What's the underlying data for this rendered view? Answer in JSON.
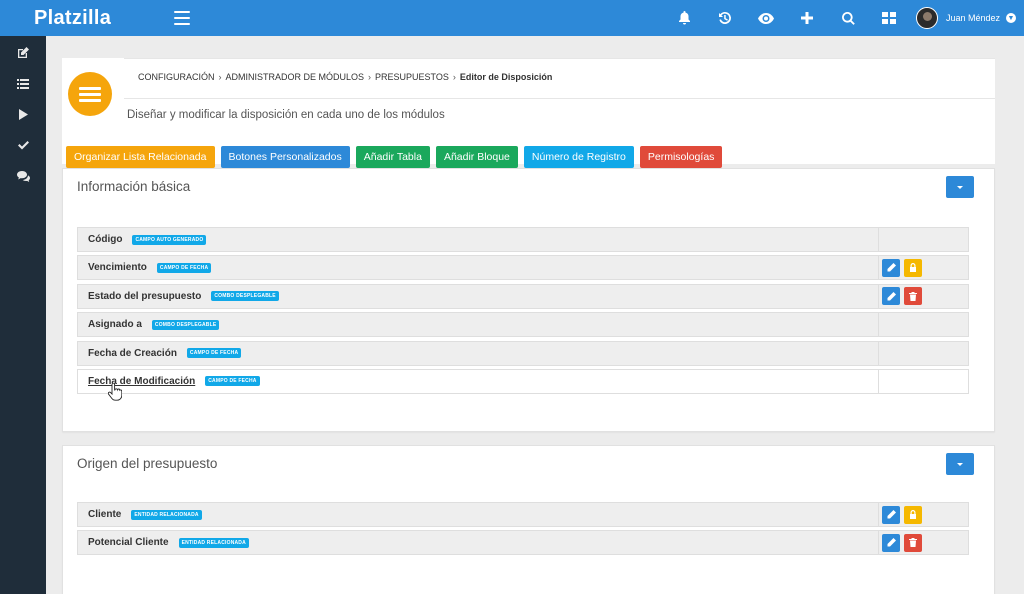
{
  "app": {
    "brand": "Platzilla"
  },
  "topbar": {
    "icons": [
      "bell-icon",
      "history-icon",
      "eye-icon",
      "plus-icon",
      "search-icon",
      "grid-icon"
    ],
    "user_name": "Juan Méndez"
  },
  "sidebar": {
    "items": [
      "edit-icon",
      "list-icon",
      "play-icon",
      "check-icon",
      "chat-icon"
    ]
  },
  "header": {
    "breadcrumb": [
      "CONFIGURACIÓN",
      "ADMINISTRADOR DE MÓDULOS",
      "PRESUPUESTOS"
    ],
    "current": "Editor de Disposición",
    "separator": "›",
    "subtitle": "Diseñar y modificar la disposición en cada uno de los módulos"
  },
  "actions": {
    "related_list": "Organizar Lista Relacionada",
    "custom_buttons": "Botones Personalizados",
    "add_table": "Añadir Tabla",
    "add_block": "Añadir Bloque",
    "record_number": "Número de Registro",
    "permissions": "Permisologías"
  },
  "blocks": [
    {
      "title": "Información básica",
      "fields": [
        {
          "label": "Código",
          "badge": "CAMPO AUTO GENERADO",
          "actions": []
        },
        {
          "label": "Vencimiento",
          "badge": "CAMPO DE FECHA",
          "actions": [
            "edit",
            "lock"
          ]
        },
        {
          "label": "Estado del presupuesto",
          "badge": "COMBO DESPLEGABLE",
          "actions": [
            "edit",
            "delete"
          ]
        },
        {
          "label": "Asignado a",
          "badge": "COMBO DESPLEGABLE",
          "actions": []
        },
        {
          "label": "Fecha de Creación",
          "badge": "CAMPO DE FECHA",
          "actions": []
        },
        {
          "label": "Fecha de Modificación",
          "badge": "CAMPO DE FECHA",
          "actions": []
        }
      ]
    },
    {
      "title": "Origen del presupuesto",
      "fields": [
        {
          "label": "Cliente",
          "badge": "ENTIDAD RELACIONADA",
          "actions": [
            "edit",
            "lock"
          ]
        },
        {
          "label": "Potencial Cliente",
          "badge": "ENTIDAD RELACIONADA",
          "actions": [
            "edit",
            "delete"
          ]
        }
      ]
    }
  ],
  "colors": {
    "topbar": "#2d89d8",
    "sidebar": "#1f2d3a",
    "orange": "#f5a50c",
    "green": "#1aa85c",
    "cyan": "#11a8e8",
    "red": "#e04a3a"
  }
}
